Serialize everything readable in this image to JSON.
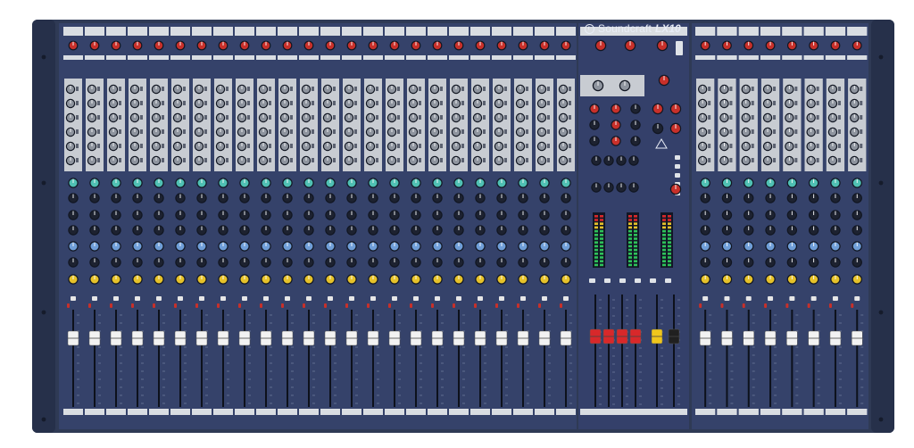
{
  "brand": {
    "name": "Soundcraft",
    "model": "LX10"
  },
  "colors": {
    "frame": "#2f3a55",
    "panel": "#35426a",
    "chrome": "#c8ccd2",
    "strip_top": "#d9dde2",
    "knob_red": "#c8302a",
    "knob_teal": "#4fc0b3",
    "knob_blue": "#6f9ed8",
    "knob_yellow": "#e6c22a",
    "knob_dark": "#1d2230",
    "knob_gray": "#cfd3d8",
    "fader_white": "#f2f2f2",
    "fader_red": "#d8282a",
    "fader_yellow": "#f0c61c",
    "fader_black": "#202020",
    "led_green": "#2ec25a"
  },
  "layout_counts": {
    "left_channels": 24,
    "right_channels": 8,
    "master_faders": 6
  }
}
